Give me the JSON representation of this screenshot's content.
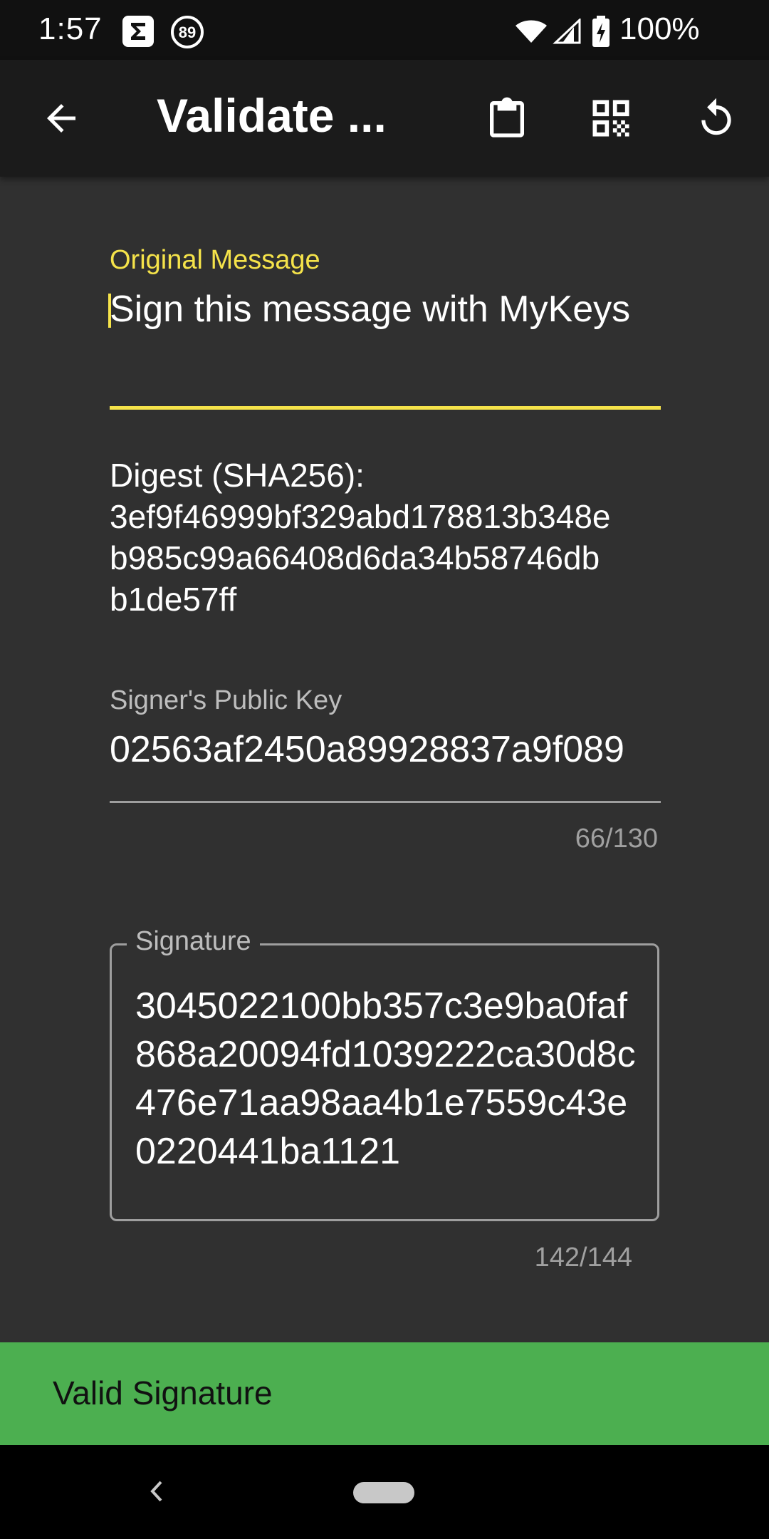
{
  "status_bar": {
    "time": "1:57",
    "notification_badge": "89",
    "battery": "100%",
    "icons": [
      "sigma-icon",
      "notification-badge-icon",
      "wifi-icon",
      "cell-signal-icon",
      "battery-charging-icon"
    ]
  },
  "app_bar": {
    "title": "Validate ...",
    "icons": [
      "back-arrow-icon",
      "clipboard-icon",
      "qr-code-icon",
      "refresh-icon"
    ]
  },
  "form": {
    "message_label": "Original Message",
    "message_value": "Sign this message with MyKeys",
    "digest_lines": [
      "Digest (SHA256):",
      "3ef9f46999bf329abd178813b348e",
      "b985c99a66408d6da34b58746db",
      "b1de57ff"
    ],
    "pubkey_label": "Signer's Public Key",
    "pubkey_value": "02563af2450a89928837a9f089",
    "pubkey_counter": "66/130",
    "signature_label": "Signature",
    "signature_value": "3045022100bb357c3e9ba0faf868a20094fd1039222ca30d8c476e71aa98aa4b1e7559c43e0220441ba1121",
    "signature_counter": "142/144"
  },
  "snackbar": {
    "message": "Valid Signature",
    "color": "#4caf50"
  },
  "colors": {
    "accent": "#f5e34a",
    "background": "#303030",
    "app_bar": "#1b1b1b"
  }
}
